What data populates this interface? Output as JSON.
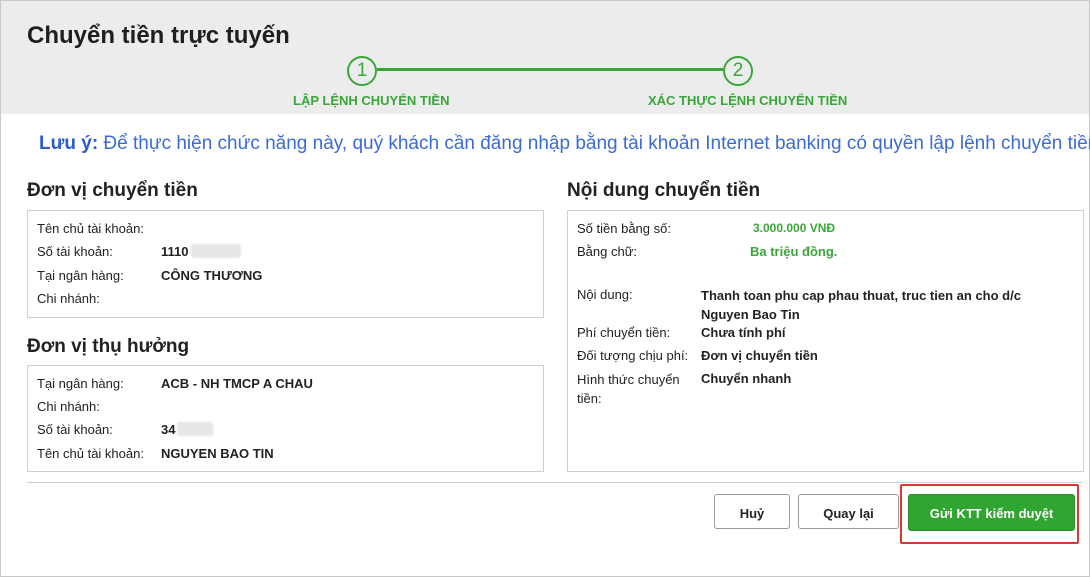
{
  "title": "Chuyển tiền trực tuyến",
  "steps": [
    {
      "number": "1",
      "label": "LẬP LỆNH CHUYỂN TIỀN"
    },
    {
      "number": "2",
      "label": "XÁC THỰC LỆNH CHUYỂN TIỀN"
    }
  ],
  "note": {
    "prefix": "Lưu ý:",
    "text": " Để thực hiện chức năng này, quý khách cần đăng nhập bằng tài khoản Internet banking có quyền lập lệnh chuyển tiền"
  },
  "sender": {
    "title": "Đơn vị chuyển tiền",
    "account_holder_label": "Tên chủ tài khoản:",
    "account_holder_value": "",
    "account_number_label": "Số tài khoản:",
    "account_number_value": "1110",
    "bank_label": "Tại ngân hàng:",
    "bank_value": "CÔNG THƯƠNG",
    "branch_label": "Chi nhánh:",
    "branch_value": ""
  },
  "beneficiary": {
    "title": "Đơn vị thụ hưởng",
    "bank_label": "Tại ngân hàng:",
    "bank_value": "ACB - NH TMCP A CHAU",
    "branch_label": "Chi nhánh:",
    "branch_value": "",
    "account_number_label": "Số tài khoản:",
    "account_number_value": "34",
    "account_holder_label": "Tên chủ tài khoản:",
    "account_holder_value": "NGUYEN BAO TIN"
  },
  "content": {
    "title": "Nội dung chuyển tiền",
    "amount_number_label": "Số tiền bằng số:",
    "amount_number_value": "3.000.000 VNĐ",
    "amount_words_label": "Bằng chữ:",
    "amount_words_value": "Ba triệu đồng.",
    "description_label": "Nội dung:",
    "description_value": "Thanh toan phu cap phau thuat, truc tien an cho d/c Nguyen Bao Tin",
    "fee_label": "Phí chuyển tiền:",
    "fee_value": "Chưa tính phí",
    "fee_payer_label": "Đối tượng chịu phí:",
    "fee_payer_value": "Đơn vị chuyển tiền",
    "transfer_type_label": "Hình thức chuyển tiền:",
    "transfer_type_value": "Chuyển nhanh"
  },
  "buttons": {
    "cancel": "Huỷ",
    "back": "Quay lại",
    "submit": "Gửi KTT kiểm duyệt"
  },
  "colors": {
    "accent_green": "#31a531",
    "note_blue": "#3b6bd4",
    "highlight_red": "#e03434"
  }
}
